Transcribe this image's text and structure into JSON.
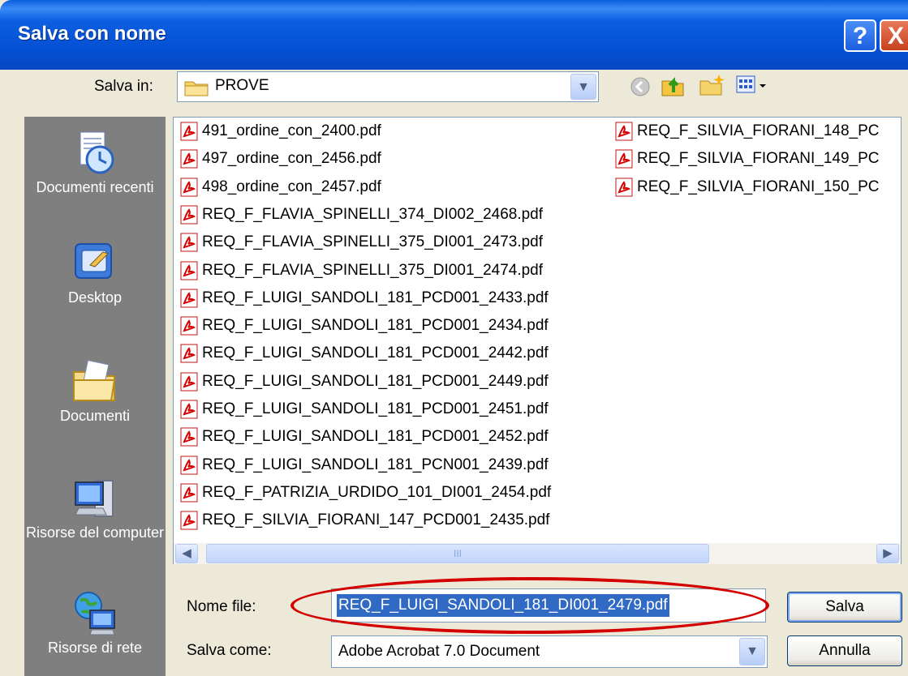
{
  "window": {
    "title": "Salva con nome"
  },
  "titlebar": {
    "help": "?",
    "close": "X"
  },
  "save_in": {
    "label": "Salva in:",
    "value": "PROVE"
  },
  "toolbar": {
    "back_icon": "back-icon",
    "up_icon": "up-folder-icon",
    "new_folder_icon": "new-folder-icon",
    "views_icon": "views-menu-icon"
  },
  "places": [
    {
      "label": "Documenti recenti",
      "icon": "recent-documents-icon"
    },
    {
      "label": "Desktop",
      "icon": "desktop-icon"
    },
    {
      "label": "Documenti",
      "icon": "documents-icon"
    },
    {
      "label": "Risorse del computer",
      "icon": "my-computer-icon"
    },
    {
      "label": "Risorse di rete",
      "icon": "network-icon"
    }
  ],
  "files_col1": [
    "491_ordine_con_2400.pdf",
    "497_ordine_con_2456.pdf",
    "498_ordine_con_2457.pdf",
    "REQ_F_FLAVIA_SPINELLI_374_DI002_2468.pdf",
    "REQ_F_FLAVIA_SPINELLI_375_DI001_2473.pdf",
    "REQ_F_FLAVIA_SPINELLI_375_DI001_2474.pdf",
    "REQ_F_LUIGI_SANDOLI_181_PCD001_2433.pdf",
    "REQ_F_LUIGI_SANDOLI_181_PCD001_2434.pdf",
    "REQ_F_LUIGI_SANDOLI_181_PCD001_2442.pdf",
    "REQ_F_LUIGI_SANDOLI_181_PCD001_2449.pdf",
    "REQ_F_LUIGI_SANDOLI_181_PCD001_2451.pdf",
    "REQ_F_LUIGI_SANDOLI_181_PCD001_2452.pdf",
    "REQ_F_LUIGI_SANDOLI_181_PCN001_2439.pdf",
    "REQ_F_PATRIZIA_URDIDO_101_DI001_2454.pdf",
    "REQ_F_SILVIA_FIORANI_147_PCD001_2435.pdf"
  ],
  "files_col2": [
    "REQ_F_SILVIA_FIORANI_148_PC",
    "REQ_F_SILVIA_FIORANI_149_PC",
    "REQ_F_SILVIA_FIORANI_150_PC"
  ],
  "scrollbar": {
    "thumb_grip": "III"
  },
  "filename": {
    "label": "Nome file:",
    "value": "REQ_F_LUIGI_SANDOLI_181_DI001_2479.pdf"
  },
  "filetype": {
    "label": "Salva come:",
    "value": "Adobe Acrobat 7.0 Document"
  },
  "buttons": {
    "save": "Salva",
    "cancel": "Annulla"
  },
  "colors": {
    "title_bar": "#0550d4",
    "annotation": "#d40000",
    "selection": "#316ac5"
  }
}
